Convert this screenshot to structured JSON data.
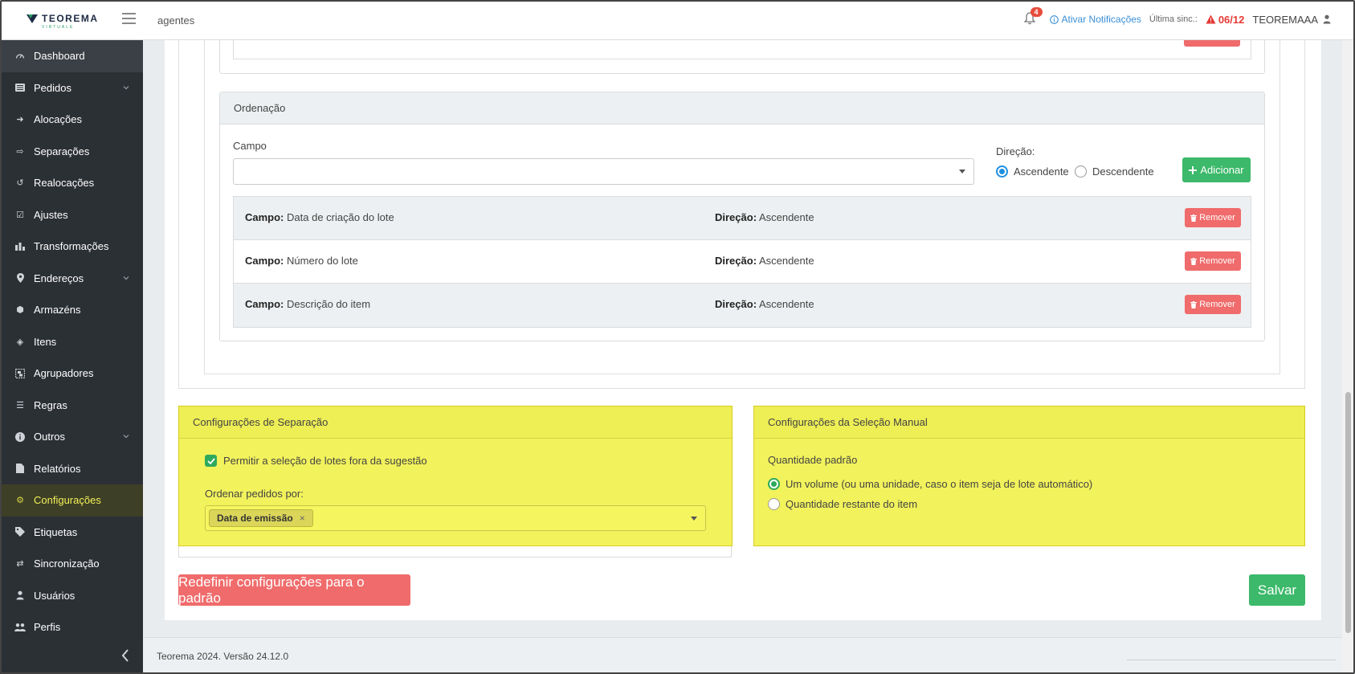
{
  "topbar": {
    "logo_text": "TEOREMA",
    "logo_sub": "VIRTUALE",
    "breadcrumb": "agentes",
    "notification_count": "4",
    "notif_link": "Ativar Notificações",
    "sync_label": "Última sinc.:",
    "sync_value": "06/12",
    "user_name": "TEOREMAAA"
  },
  "sidebar": {
    "items": [
      {
        "label": "Dashboard",
        "icon": "dashboard-icon"
      },
      {
        "label": "Pedidos",
        "icon": "list-icon",
        "has_children": true
      },
      {
        "label": "Alocações",
        "icon": "sign-in-icon"
      },
      {
        "label": "Separações",
        "icon": "sign-out-icon"
      },
      {
        "label": "Realocações",
        "icon": "undo-icon"
      },
      {
        "label": "Ajustes",
        "icon": "check-square-icon"
      },
      {
        "label": "Transformações",
        "icon": "bar-chart-icon"
      },
      {
        "label": "Endereços",
        "icon": "map-marker-icon",
        "has_children": true
      },
      {
        "label": "Armazéns",
        "icon": "cubes-icon"
      },
      {
        "label": "Itens",
        "icon": "cube-icon"
      },
      {
        "label": "Agrupadores",
        "icon": "object-group-icon"
      },
      {
        "label": "Regras",
        "icon": "list-ul-icon"
      },
      {
        "label": "Outros",
        "icon": "info-circle-icon",
        "has_children": true
      },
      {
        "label": "Relatórios",
        "icon": "file-icon"
      },
      {
        "label": "Configurações",
        "icon": "gear-icon",
        "active": true
      },
      {
        "label": "Etiquetas",
        "icon": "tags-icon"
      },
      {
        "label": "Sincronização",
        "icon": "exchange-icon"
      },
      {
        "label": "Usuários",
        "icon": "user-icon"
      },
      {
        "label": "Perfis",
        "icon": "users-icon"
      }
    ]
  },
  "ordenacao": {
    "title": "Ordenação",
    "campo_label": "Campo",
    "campo_value": "",
    "direcao_label": "Direção:",
    "direcao_options": [
      "Ascendente",
      "Descendente"
    ],
    "direcao_selected": "Ascendente",
    "add_button": "Adicionar",
    "field_prefix": "Campo:",
    "dir_prefix": "Direção:",
    "remove_label": "Remover",
    "rows": [
      {
        "campo": "Data de criação do lote",
        "direcao": "Ascendente"
      },
      {
        "campo": "Número do lote",
        "direcao": "Ascendente"
      },
      {
        "campo": "Descrição do item",
        "direcao": "Ascendente"
      }
    ]
  },
  "separacao": {
    "title": "Configurações de Separação",
    "checkbox_label": "Permitir a seleção de lotes fora da sugestão",
    "checkbox_checked": true,
    "ordenar_label": "Ordenar pedidos por:",
    "ordenar_tag": "Data de emissão"
  },
  "selecao_manual": {
    "title": "Configurações da Seleção Manual",
    "quantidade_label": "Quantidade padrão",
    "options": [
      "Um volume (ou uma unidade, caso o item seja de lote automático)",
      "Quantidade restante do item"
    ],
    "selected_index": 0
  },
  "actions": {
    "reset_label": "Redefinir configurações para o padrão",
    "save_label": "Salvar"
  },
  "footer": {
    "text": "Teorema 2024. Versão 24.12.0"
  },
  "colors": {
    "sidebar_bg": "#2b3035",
    "active_item_text": "#f3f05a",
    "highlight_yellow": "#f2f25c",
    "success": "#3cb96a",
    "danger": "#f06b6b",
    "link_blue": "#3a8fd6"
  }
}
